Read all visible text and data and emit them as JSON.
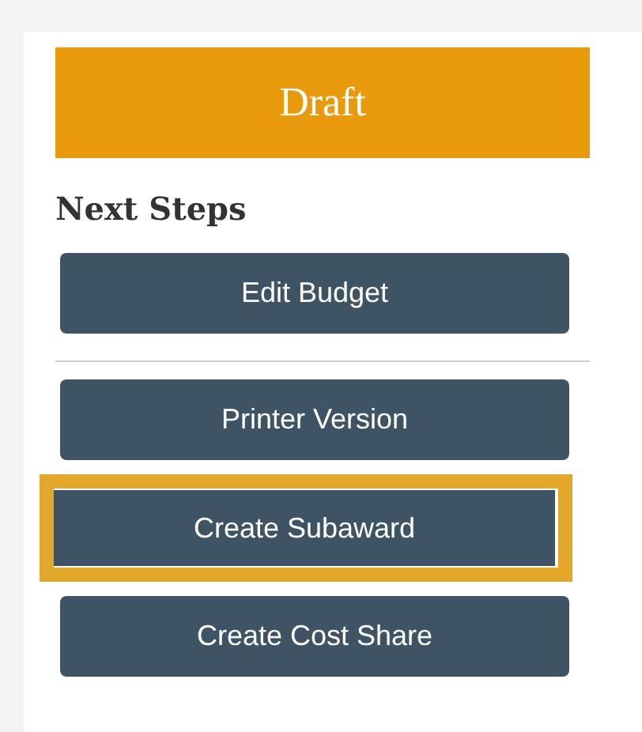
{
  "status": {
    "label": "Draft"
  },
  "heading": "Next Steps",
  "action_groups": [
    [
      {
        "label": "Edit Budget",
        "highlighted": false
      }
    ],
    [
      {
        "label": "Printer Version",
        "highlighted": false
      },
      {
        "label": "Create Subaward",
        "highlighted": true
      },
      {
        "label": "Create Cost Share",
        "highlighted": false
      }
    ]
  ]
}
